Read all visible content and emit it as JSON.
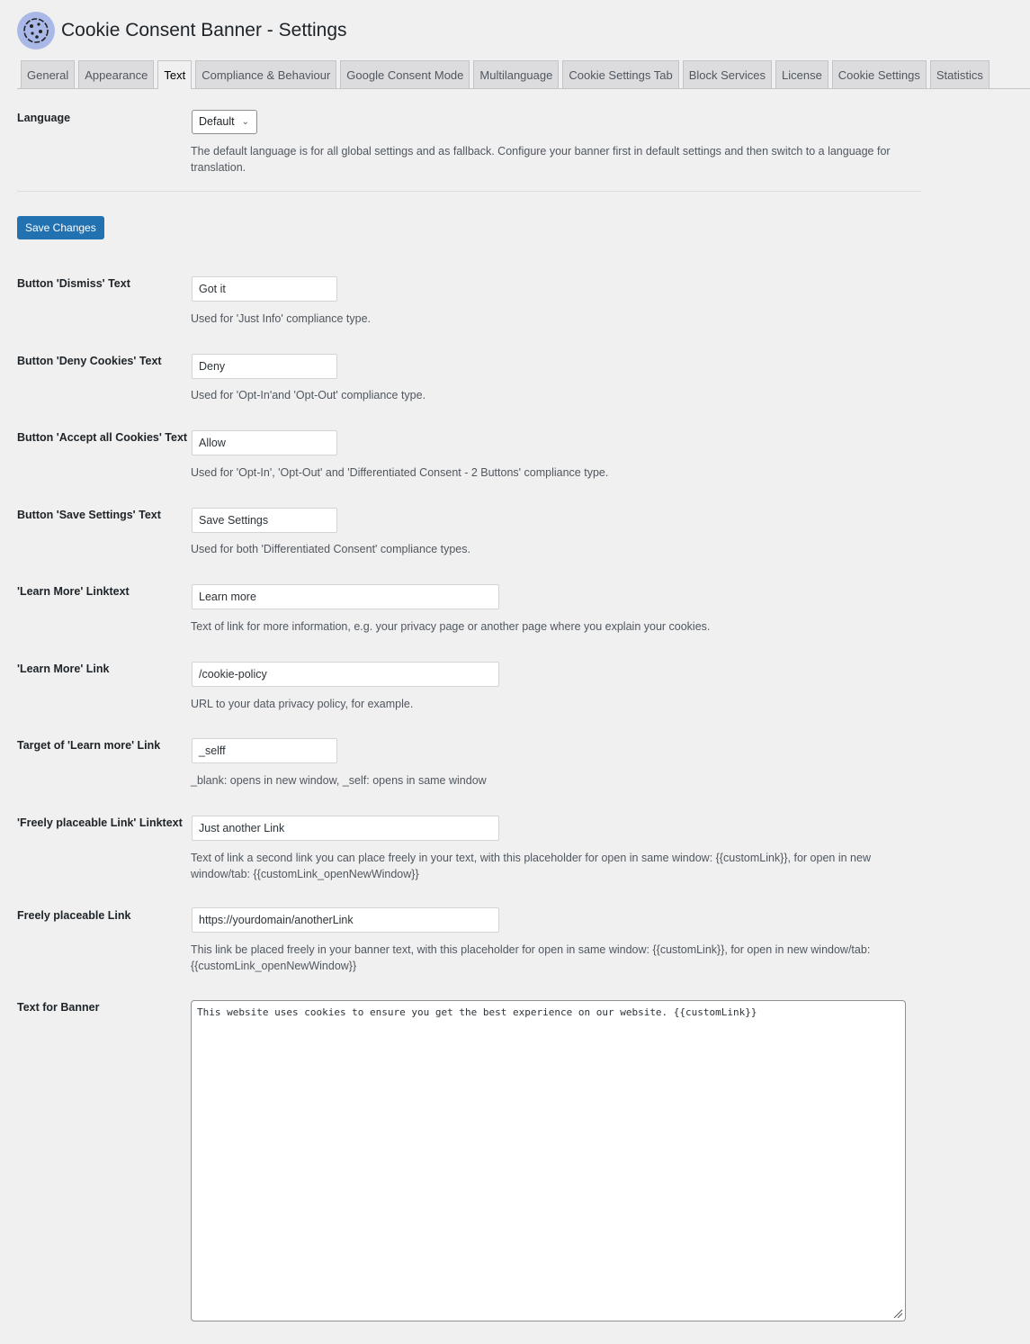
{
  "header": {
    "title": "Cookie Consent Banner - Settings",
    "logo_icon": "cookie-icon"
  },
  "tabs": [
    {
      "label": "General",
      "active": false
    },
    {
      "label": "Appearance",
      "active": false
    },
    {
      "label": "Text",
      "active": true
    },
    {
      "label": "Compliance & Behaviour",
      "active": false
    },
    {
      "label": "Google Consent Mode",
      "active": false
    },
    {
      "label": "Multilanguage",
      "active": false
    },
    {
      "label": "Cookie Settings Tab",
      "active": false
    },
    {
      "label": "Block Services",
      "active": false
    },
    {
      "label": "License",
      "active": false
    },
    {
      "label": "Cookie Settings",
      "active": false
    },
    {
      "label": "Statistics",
      "active": false
    }
  ],
  "language": {
    "label": "Language",
    "value": "Default",
    "description": "The default language is for all global settings and as fallback. Configure your banner first in default settings and then switch to a language for translation."
  },
  "save_label": "Save Changes",
  "fields": [
    {
      "label": "Button 'Dismiss' Text",
      "value": "Got it",
      "description": "Used for 'Just Info' compliance type."
    },
    {
      "label": "Button 'Deny Cookies' Text",
      "value": "Deny",
      "description": "Used for 'Opt-In'and 'Opt-Out' compliance type."
    },
    {
      "label": "Button 'Accept all Cookies' Text",
      "value": "Allow",
      "description": "Used for 'Opt-In', 'Opt-Out' and 'Differentiated Consent - 2 Buttons' compliance type."
    },
    {
      "label": "Button 'Save Settings' Text",
      "value": "Save Settings",
      "description": "Used for both 'Differentiated Consent' compliance types."
    },
    {
      "label": "'Learn More' Linktext",
      "value": "Learn more",
      "description": "Text of link for more information, e.g. your privacy page or another page where you explain your cookies."
    },
    {
      "label": "'Learn More' Link",
      "value": "/cookie-policy",
      "description": "URL to your data privacy policy, for example."
    },
    {
      "label": "Target of 'Learn more' Link",
      "value": "_selff",
      "description": "_blank: opens in new window, _self: opens in same window"
    },
    {
      "label": "'Freely placeable Link' Linktext",
      "value": "Just another Link",
      "description": "Text of link a second link you can place freely in your text, with this placeholder for open in same window: {{customLink}}, for open in new window/tab: {{customLink_openNewWindow}}"
    },
    {
      "label": "Freely placeable Link",
      "value": "https://yourdomain/anotherLink",
      "description": "This link be placed freely in your banner text, with this placeholder for open in same window: {{customLink}}, for open in new window/tab: {{customLink_openNewWindow}}"
    }
  ],
  "banner": {
    "label": "Text for Banner",
    "value": "This website uses cookies to ensure you get the best experience on our website. {{customLink}}"
  }
}
